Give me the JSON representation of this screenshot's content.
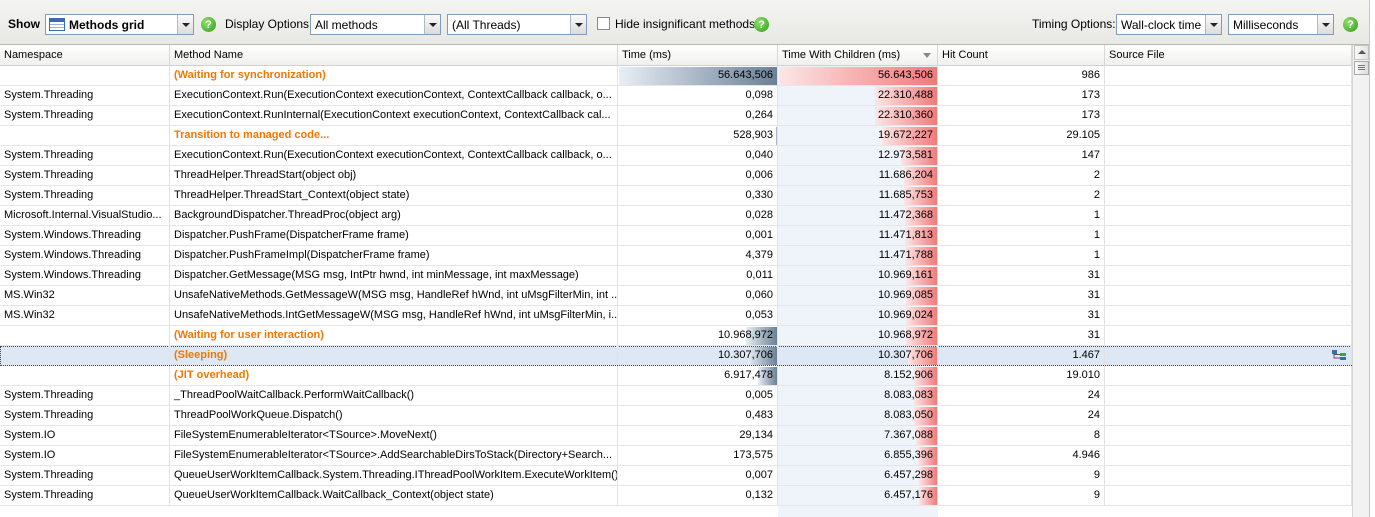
{
  "toolbar": {
    "show_label": "Show",
    "view_value": "Methods grid",
    "display_options_label": "Display Options:",
    "methods_filter_value": "All methods",
    "threads_filter_value": "(All Threads)",
    "hide_insignificant_label": "Hide insignificant methods",
    "hide_insignificant_checked": false,
    "timing_options_label": "Timing Options:",
    "timing_value": "Wall-clock time",
    "units_value": "Milliseconds",
    "help_glyph": "?"
  },
  "columns": {
    "namespace": "Namespace",
    "method_name": "Method Name",
    "time": "Time (ms)",
    "time_with_children": "Time With Children (ms)",
    "hit_count": "Hit Count",
    "source_file": "Source File"
  },
  "colors": {
    "special_text": "#f07800",
    "time_bar": "#6a8096",
    "twc_bar": "#f07a7a",
    "selection": "#dde8f4"
  },
  "rows": [
    {
      "namespace": "",
      "method": "(Waiting for synchronization)",
      "special": true,
      "time": "56.643,506",
      "twc": "56.643,506",
      "hits": "986",
      "source": "",
      "time_ms": 56643.506,
      "twc_ms": 56643.506
    },
    {
      "namespace": "System.Threading",
      "method": "ExecutionContext.Run(ExecutionContext executionContext, ContextCallback callback, o...",
      "special": false,
      "time": "0,098",
      "twc": "22.310,488",
      "hits": "173",
      "source": "",
      "time_ms": 0.098,
      "twc_ms": 22310.488
    },
    {
      "namespace": "System.Threading",
      "method": "ExecutionContext.RunInternal(ExecutionContext executionContext, ContextCallback cal...",
      "special": false,
      "time": "0,264",
      "twc": "22.310,360",
      "hits": "173",
      "source": "",
      "time_ms": 0.264,
      "twc_ms": 22310.36
    },
    {
      "namespace": "",
      "method": "Transition to managed code...",
      "special": true,
      "time": "528,903",
      "twc": "19.672,227",
      "hits": "29.105",
      "source": "",
      "time_ms": 528.903,
      "twc_ms": 19672.227
    },
    {
      "namespace": "System.Threading",
      "method": "ExecutionContext.Run(ExecutionContext executionContext, ContextCallback callback, o...",
      "special": false,
      "time": "0,040",
      "twc": "12.973,581",
      "hits": "147",
      "source": "",
      "time_ms": 0.04,
      "twc_ms": 12973.581
    },
    {
      "namespace": "System.Threading",
      "method": "ThreadHelper.ThreadStart(object obj)",
      "special": false,
      "time": "0,006",
      "twc": "11.686,204",
      "hits": "2",
      "source": "",
      "time_ms": 0.006,
      "twc_ms": 11686.204
    },
    {
      "namespace": "System.Threading",
      "method": "ThreadHelper.ThreadStart_Context(object state)",
      "special": false,
      "time": "0,330",
      "twc": "11.685,753",
      "hits": "2",
      "source": "",
      "time_ms": 0.33,
      "twc_ms": 11685.753
    },
    {
      "namespace": "Microsoft.Internal.VisualStudio...",
      "method": "BackgroundDispatcher.ThreadProc(object arg)",
      "special": false,
      "time": "0,028",
      "twc": "11.472,368",
      "hits": "1",
      "source": "",
      "time_ms": 0.028,
      "twc_ms": 11472.368
    },
    {
      "namespace": "System.Windows.Threading",
      "method": "Dispatcher.PushFrame(DispatcherFrame frame)",
      "special": false,
      "time": "0,001",
      "twc": "11.471,813",
      "hits": "1",
      "source": "",
      "time_ms": 0.001,
      "twc_ms": 11471.813
    },
    {
      "namespace": "System.Windows.Threading",
      "method": "Dispatcher.PushFrameImpl(DispatcherFrame frame)",
      "special": false,
      "time": "4,379",
      "twc": "11.471,788",
      "hits": "1",
      "source": "",
      "time_ms": 4.379,
      "twc_ms": 11471.788
    },
    {
      "namespace": "System.Windows.Threading",
      "method": "Dispatcher.GetMessage(MSG msg, IntPtr hwnd, int minMessage, int maxMessage)",
      "special": false,
      "time": "0,011",
      "twc": "10.969,161",
      "hits": "31",
      "source": "",
      "time_ms": 0.011,
      "twc_ms": 10969.161
    },
    {
      "namespace": "MS.Win32",
      "method": "UnsafeNativeMethods.GetMessageW(MSG msg, HandleRef hWnd, int uMsgFilterMin, int ...",
      "special": false,
      "time": "0,060",
      "twc": "10.969,085",
      "hits": "31",
      "source": "",
      "time_ms": 0.06,
      "twc_ms": 10969.085
    },
    {
      "namespace": "MS.Win32",
      "method": "UnsafeNativeMethods.IntGetMessageW(MSG msg, HandleRef hWnd, int uMsgFilterMin, i...",
      "special": false,
      "time": "0,053",
      "twc": "10.969,024",
      "hits": "31",
      "source": "",
      "time_ms": 0.053,
      "twc_ms": 10969.024
    },
    {
      "namespace": "",
      "method": "(Waiting for user interaction)",
      "special": true,
      "time": "10.968,972",
      "twc": "10.968,972",
      "hits": "31",
      "source": "",
      "time_ms": 10968.972,
      "twc_ms": 10968.972
    },
    {
      "namespace": "",
      "method": "(Sleeping)",
      "special": true,
      "selected": true,
      "time": "10.307,706",
      "twc": "10.307,706",
      "hits": "1.467",
      "source": "",
      "time_ms": 10307.706,
      "twc_ms": 10307.706
    },
    {
      "namespace": "",
      "method": "(JIT overhead)",
      "special": true,
      "time": "6.917,478",
      "twc": "8.152,906",
      "hits": "19.010",
      "source": "",
      "time_ms": 6917.478,
      "twc_ms": 8152.906
    },
    {
      "namespace": "System.Threading",
      "method": "_ThreadPoolWaitCallback.PerformWaitCallback()",
      "special": false,
      "time": "0,005",
      "twc": "8.083,083",
      "hits": "24",
      "source": "",
      "time_ms": 0.005,
      "twc_ms": 8083.083
    },
    {
      "namespace": "System.Threading",
      "method": "ThreadPoolWorkQueue.Dispatch()",
      "special": false,
      "time": "0,483",
      "twc": "8.083,050",
      "hits": "24",
      "source": "",
      "time_ms": 0.483,
      "twc_ms": 8083.05
    },
    {
      "namespace": "System.IO",
      "method": "FileSystemEnumerableIterator<TSource>.MoveNext()",
      "special": false,
      "time": "29,134",
      "twc": "7.367,088",
      "hits": "8",
      "source": "",
      "time_ms": 29.134,
      "twc_ms": 7367.088
    },
    {
      "namespace": "System.IO",
      "method": "FileSystemEnumerableIterator<TSource>.AddSearchableDirsToStack(Directory+Search...",
      "special": false,
      "time": "173,575",
      "twc": "6.855,396",
      "hits": "4.946",
      "source": "",
      "time_ms": 173.575,
      "twc_ms": 6855.396
    },
    {
      "namespace": "System.Threading",
      "method": "QueueUserWorkItemCallback.System.Threading.IThreadPoolWorkItem.ExecuteWorkItem()",
      "special": false,
      "time": "0,007",
      "twc": "6.457,298",
      "hits": "9",
      "source": "",
      "time_ms": 0.007,
      "twc_ms": 6457.298
    },
    {
      "namespace": "System.Threading",
      "method": "QueueUserWorkItemCallback.WaitCallback_Context(object state)",
      "special": false,
      "time": "0,132",
      "twc": "6.457,176",
      "hits": "9",
      "source": "",
      "time_ms": 0.132,
      "twc_ms": 6457.176
    }
  ],
  "max_ms": 56643.506
}
